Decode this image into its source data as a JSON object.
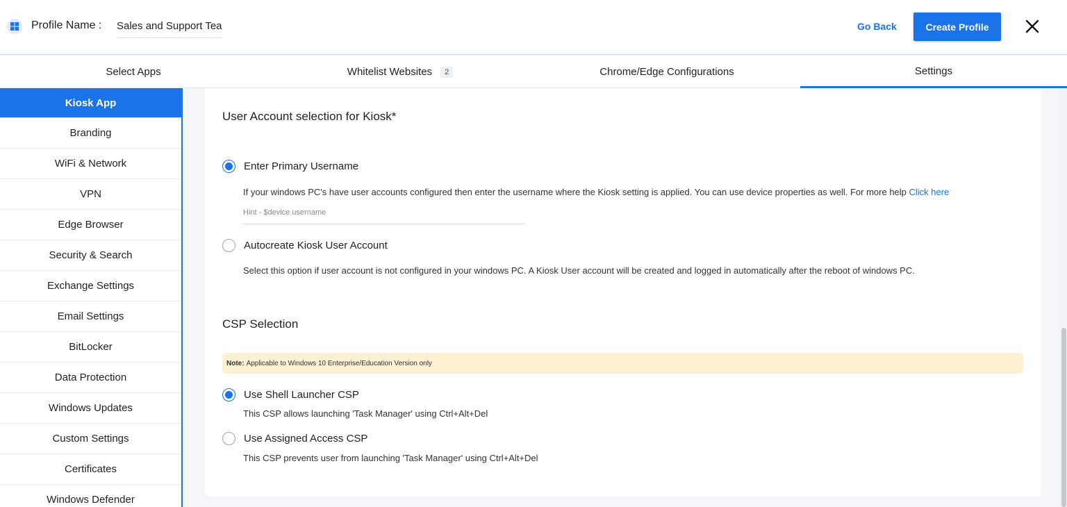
{
  "header": {
    "profile_label": "Profile Name :",
    "profile_value": "Sales and Support Tea",
    "go_back": "Go Back",
    "create_profile": "Create Profile"
  },
  "tabs": [
    {
      "label": "Select Apps"
    },
    {
      "label": "Whitelist Websites",
      "badge": "2"
    },
    {
      "label": "Chrome/Edge Configurations"
    },
    {
      "label": "Settings",
      "active": true
    }
  ],
  "sidebar": {
    "items": [
      {
        "label": "Kiosk App",
        "active": true
      },
      {
        "label": "Branding"
      },
      {
        "label": "WiFi & Network"
      },
      {
        "label": "VPN"
      },
      {
        "label": "Edge Browser"
      },
      {
        "label": "Security & Search"
      },
      {
        "label": "Exchange Settings"
      },
      {
        "label": "Email Settings"
      },
      {
        "label": "BitLocker"
      },
      {
        "label": "Data Protection"
      },
      {
        "label": "Windows Updates"
      },
      {
        "label": "Custom Settings"
      },
      {
        "label": "Certificates"
      },
      {
        "label": "Windows Defender"
      }
    ]
  },
  "main": {
    "user_account_title": "User Account selection for Kiosk*",
    "primary_option": {
      "label": "Enter Primary Username",
      "checked": true,
      "description": "If your windows PC's have user accounts configured then enter the username where the Kiosk setting is applied. You can use device properties as well. For more help ",
      "link": "Click here",
      "hint_placeholder": "Hint - $device.username"
    },
    "autocreate_option": {
      "label": "Autocreate Kiosk User Account",
      "checked": false,
      "description": "Select this option if user account is not configured in your windows PC. A Kiosk User account will be created and logged in automatically after the reboot of windows PC."
    },
    "csp_title": "CSP Selection",
    "note_label": "Note:",
    "note_text": "Applicable to Windows 10 Enterprise/Education Version only",
    "shell_option": {
      "label": "Use Shell Launcher CSP",
      "checked": true,
      "description": "This CSP allows launching 'Task Manager' using Ctrl+Alt+Del"
    },
    "assigned_option": {
      "label": "Use Assigned Access CSP",
      "checked": false,
      "description": "This CSP prevents user from launching 'Task Manager' using Ctrl+Alt+Del"
    }
  },
  "colors": {
    "accent": "#1a73e8",
    "note_bg": "#fbf0d2"
  },
  "icons": {
    "header_icon": "windows-icon",
    "close": "close-icon"
  }
}
